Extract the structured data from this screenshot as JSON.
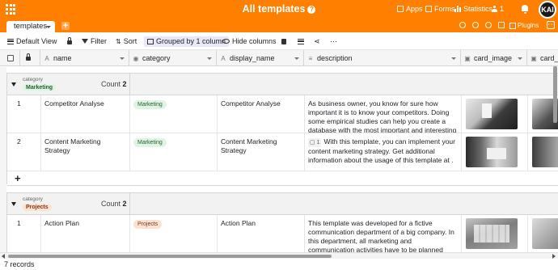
{
  "app": {
    "title": "All templates"
  },
  "nav": {
    "apps": "Apps",
    "forms": "Forms",
    "statistics": "Statistics",
    "users_count": "1",
    "avatar_initials": "KAI"
  },
  "tabs": [
    {
      "label": "templates"
    }
  ],
  "tabbar": {
    "plugins": "Plugins"
  },
  "toolbar": {
    "view": "Default View",
    "filter": "Filter",
    "sort": "Sort",
    "grouped": "Grouped by 1 column",
    "hide_columns": "Hide columns"
  },
  "columns": [
    {
      "label": "name",
      "type_icon": "A"
    },
    {
      "label": "category",
      "type_icon": "◉"
    },
    {
      "label": "display_name",
      "type_icon": "A"
    },
    {
      "label": "description",
      "type_icon": "≡"
    },
    {
      "label": "card_image",
      "type_icon": "▣"
    },
    {
      "label": "card_im",
      "type_icon": "▣"
    }
  ],
  "groups": [
    {
      "label": "category",
      "value": "Marketing",
      "count_label": "Count",
      "count": "2",
      "rows": [
        {
          "index": "1",
          "name": "Competitor Analyse",
          "category": "Marketing",
          "display_name": "Competitor Analyse",
          "description": "As business owner, you know for sure how important it is to know your competitors. Doing some empirical studies can help you create a database with the most important and interesting features and updates of ...",
          "attachments": ""
        },
        {
          "index": "2",
          "name": "Content Marketing Strategy",
          "category": "Marketing",
          "display_name": "Content Marketing Strategy",
          "description": "With this template, you can implement your content marketing strategy. Get additional information about the usage of this template at .",
          "attachments": "1"
        }
      ]
    },
    {
      "label": "category",
      "value": "Projects",
      "count_label": "Count",
      "count": "2",
      "rows": [
        {
          "index": "1",
          "name": "Action Plan",
          "category": "Projects",
          "display_name": "Action Plan",
          "description": "This template was developed for a fictive communication department of a big company. In this department, all marketing and communication activities have to be planned very early, often on year...",
          "attachments": ""
        }
      ]
    }
  ],
  "footer": {
    "records": "7 records"
  },
  "colors": {
    "brand": "#ff8000",
    "chip_marketing": "#dff5e3",
    "chip_projects": "#fde1d1"
  }
}
